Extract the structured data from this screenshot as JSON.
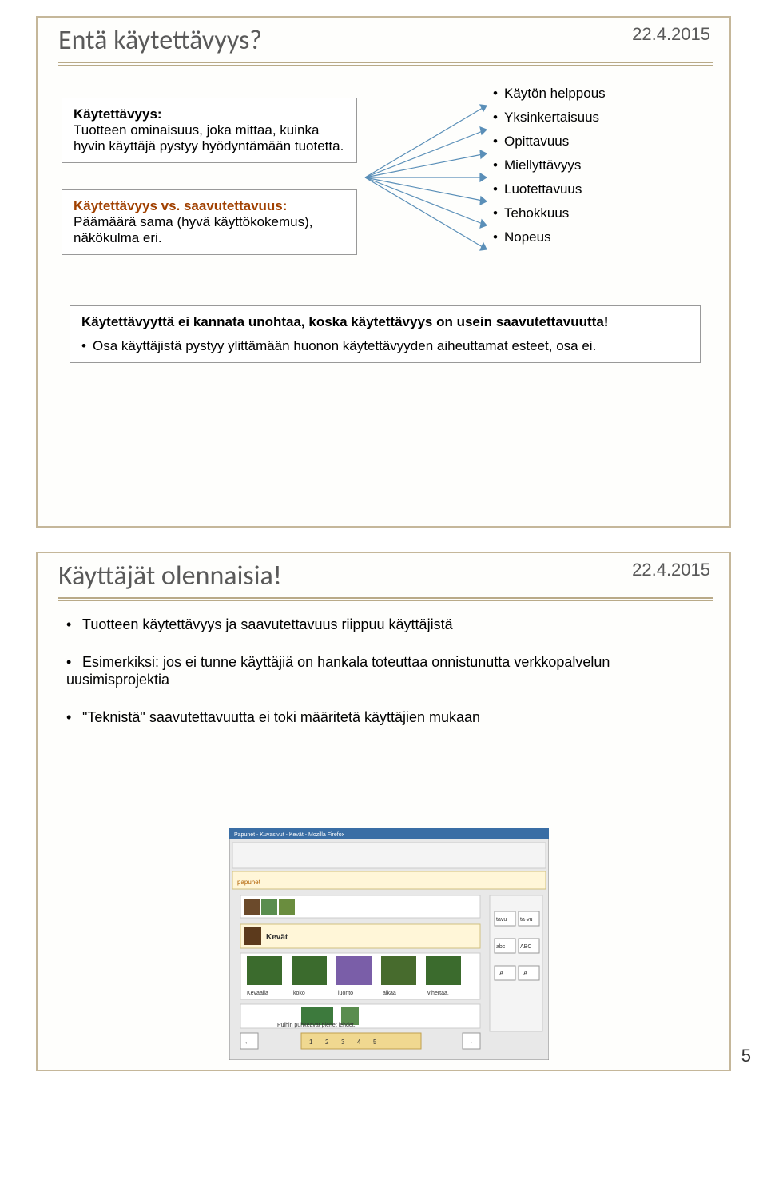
{
  "slide1": {
    "title": "Entä käytettävyys?",
    "date": "22.4.2015",
    "box1": {
      "heading": "Käytettävyys:",
      "body": "Tuotteen ominaisuus, joka mittaa, kuinka hyvin käyttäjä pystyy hyödyntämään tuotetta."
    },
    "box2": {
      "heading": "Käytettävyys vs. saavutettavuus:",
      "body": "Päämäärä sama (hyvä käyttökokemus), näkökulma eri."
    },
    "attributes": [
      "Käytön helppous",
      "Yksinkertaisuus",
      "Opittavuus",
      "Miellyttävyys",
      "Luotettavuus",
      "Tehokkuus",
      "Nopeus"
    ],
    "box3": {
      "line1": "Käytettävyyttä ei kannata unohtaa, koska käytettävyys on usein saavutettavuutta!",
      "line2": "Osa käyttäjistä pystyy ylittämään huonon käytettävyyden aiheuttamat esteet, osa ei."
    }
  },
  "slide2": {
    "title": "Käyttäjät olennaisia!",
    "date": "22.4.2015",
    "bullets": [
      "Tuotteen käytettävyys ja saavutettavuus riippuu käyttäjistä",
      "Esimerkiksi: jos ei tunne käyttäjiä on hankala toteuttaa onnistunutta verkkopalvelun uusimisprojektia",
      "\"Teknistä\" saavutettavuutta ei toki määritetä käyttäjien mukaan"
    ],
    "screenshot": {
      "browser_title": "Papunet - Kuvasivut - Kevät - Mozilla Firefox",
      "site": "papunet",
      "page_heading": "Kevät",
      "sentence_words": [
        "Keväällä",
        "koko",
        "luonto",
        "alkaa",
        "vihertää."
      ],
      "caption2": "Puihin puhkeavat pienet lehdet.",
      "pager": [
        "1",
        "2",
        "3",
        "4",
        "5"
      ],
      "side_buttons": [
        "tavu",
        "ta-vu",
        "abc",
        "ABC",
        "A",
        "A"
      ]
    }
  },
  "page_number": "5"
}
